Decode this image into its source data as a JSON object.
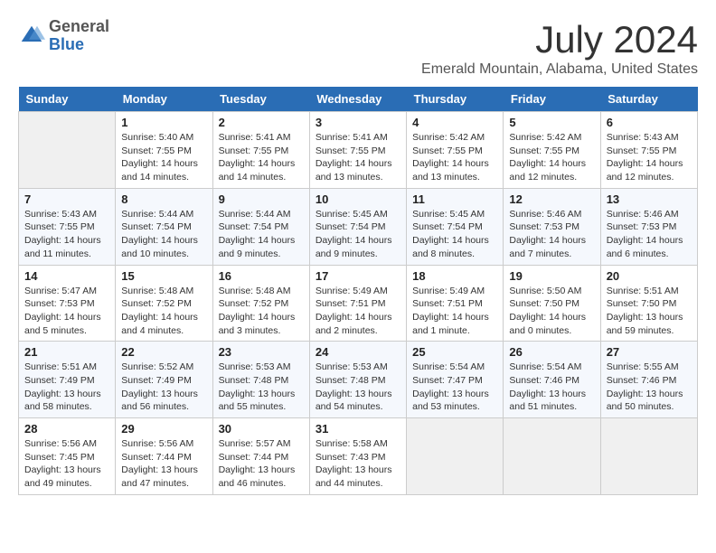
{
  "header": {
    "logo_general": "General",
    "logo_blue": "Blue",
    "month": "July 2024",
    "location": "Emerald Mountain, Alabama, United States"
  },
  "weekdays": [
    "Sunday",
    "Monday",
    "Tuesday",
    "Wednesday",
    "Thursday",
    "Friday",
    "Saturday"
  ],
  "weeks": [
    [
      {
        "day": "",
        "sunrise": "",
        "sunset": "",
        "daylight": "",
        "empty": true
      },
      {
        "day": "1",
        "sunrise": "Sunrise: 5:40 AM",
        "sunset": "Sunset: 7:55 PM",
        "daylight": "Daylight: 14 hours and 14 minutes."
      },
      {
        "day": "2",
        "sunrise": "Sunrise: 5:41 AM",
        "sunset": "Sunset: 7:55 PM",
        "daylight": "Daylight: 14 hours and 14 minutes."
      },
      {
        "day": "3",
        "sunrise": "Sunrise: 5:41 AM",
        "sunset": "Sunset: 7:55 PM",
        "daylight": "Daylight: 14 hours and 13 minutes."
      },
      {
        "day": "4",
        "sunrise": "Sunrise: 5:42 AM",
        "sunset": "Sunset: 7:55 PM",
        "daylight": "Daylight: 14 hours and 13 minutes."
      },
      {
        "day": "5",
        "sunrise": "Sunrise: 5:42 AM",
        "sunset": "Sunset: 7:55 PM",
        "daylight": "Daylight: 14 hours and 12 minutes."
      },
      {
        "day": "6",
        "sunrise": "Sunrise: 5:43 AM",
        "sunset": "Sunset: 7:55 PM",
        "daylight": "Daylight: 14 hours and 12 minutes."
      }
    ],
    [
      {
        "day": "7",
        "sunrise": "Sunrise: 5:43 AM",
        "sunset": "Sunset: 7:55 PM",
        "daylight": "Daylight: 14 hours and 11 minutes."
      },
      {
        "day": "8",
        "sunrise": "Sunrise: 5:44 AM",
        "sunset": "Sunset: 7:54 PM",
        "daylight": "Daylight: 14 hours and 10 minutes."
      },
      {
        "day": "9",
        "sunrise": "Sunrise: 5:44 AM",
        "sunset": "Sunset: 7:54 PM",
        "daylight": "Daylight: 14 hours and 9 minutes."
      },
      {
        "day": "10",
        "sunrise": "Sunrise: 5:45 AM",
        "sunset": "Sunset: 7:54 PM",
        "daylight": "Daylight: 14 hours and 9 minutes."
      },
      {
        "day": "11",
        "sunrise": "Sunrise: 5:45 AM",
        "sunset": "Sunset: 7:54 PM",
        "daylight": "Daylight: 14 hours and 8 minutes."
      },
      {
        "day": "12",
        "sunrise": "Sunrise: 5:46 AM",
        "sunset": "Sunset: 7:53 PM",
        "daylight": "Daylight: 14 hours and 7 minutes."
      },
      {
        "day": "13",
        "sunrise": "Sunrise: 5:46 AM",
        "sunset": "Sunset: 7:53 PM",
        "daylight": "Daylight: 14 hours and 6 minutes."
      }
    ],
    [
      {
        "day": "14",
        "sunrise": "Sunrise: 5:47 AM",
        "sunset": "Sunset: 7:53 PM",
        "daylight": "Daylight: 14 hours and 5 minutes."
      },
      {
        "day": "15",
        "sunrise": "Sunrise: 5:48 AM",
        "sunset": "Sunset: 7:52 PM",
        "daylight": "Daylight: 14 hours and 4 minutes."
      },
      {
        "day": "16",
        "sunrise": "Sunrise: 5:48 AM",
        "sunset": "Sunset: 7:52 PM",
        "daylight": "Daylight: 14 hours and 3 minutes."
      },
      {
        "day": "17",
        "sunrise": "Sunrise: 5:49 AM",
        "sunset": "Sunset: 7:51 PM",
        "daylight": "Daylight: 14 hours and 2 minutes."
      },
      {
        "day": "18",
        "sunrise": "Sunrise: 5:49 AM",
        "sunset": "Sunset: 7:51 PM",
        "daylight": "Daylight: 14 hours and 1 minute."
      },
      {
        "day": "19",
        "sunrise": "Sunrise: 5:50 AM",
        "sunset": "Sunset: 7:50 PM",
        "daylight": "Daylight: 14 hours and 0 minutes."
      },
      {
        "day": "20",
        "sunrise": "Sunrise: 5:51 AM",
        "sunset": "Sunset: 7:50 PM",
        "daylight": "Daylight: 13 hours and 59 minutes."
      }
    ],
    [
      {
        "day": "21",
        "sunrise": "Sunrise: 5:51 AM",
        "sunset": "Sunset: 7:49 PM",
        "daylight": "Daylight: 13 hours and 58 minutes."
      },
      {
        "day": "22",
        "sunrise": "Sunrise: 5:52 AM",
        "sunset": "Sunset: 7:49 PM",
        "daylight": "Daylight: 13 hours and 56 minutes."
      },
      {
        "day": "23",
        "sunrise": "Sunrise: 5:53 AM",
        "sunset": "Sunset: 7:48 PM",
        "daylight": "Daylight: 13 hours and 55 minutes."
      },
      {
        "day": "24",
        "sunrise": "Sunrise: 5:53 AM",
        "sunset": "Sunset: 7:48 PM",
        "daylight": "Daylight: 13 hours and 54 minutes."
      },
      {
        "day": "25",
        "sunrise": "Sunrise: 5:54 AM",
        "sunset": "Sunset: 7:47 PM",
        "daylight": "Daylight: 13 hours and 53 minutes."
      },
      {
        "day": "26",
        "sunrise": "Sunrise: 5:54 AM",
        "sunset": "Sunset: 7:46 PM",
        "daylight": "Daylight: 13 hours and 51 minutes."
      },
      {
        "day": "27",
        "sunrise": "Sunrise: 5:55 AM",
        "sunset": "Sunset: 7:46 PM",
        "daylight": "Daylight: 13 hours and 50 minutes."
      }
    ],
    [
      {
        "day": "28",
        "sunrise": "Sunrise: 5:56 AM",
        "sunset": "Sunset: 7:45 PM",
        "daylight": "Daylight: 13 hours and 49 minutes."
      },
      {
        "day": "29",
        "sunrise": "Sunrise: 5:56 AM",
        "sunset": "Sunset: 7:44 PM",
        "daylight": "Daylight: 13 hours and 47 minutes."
      },
      {
        "day": "30",
        "sunrise": "Sunrise: 5:57 AM",
        "sunset": "Sunset: 7:44 PM",
        "daylight": "Daylight: 13 hours and 46 minutes."
      },
      {
        "day": "31",
        "sunrise": "Sunrise: 5:58 AM",
        "sunset": "Sunset: 7:43 PM",
        "daylight": "Daylight: 13 hours and 44 minutes."
      },
      {
        "day": "",
        "sunrise": "",
        "sunset": "",
        "daylight": "",
        "empty": true
      },
      {
        "day": "",
        "sunrise": "",
        "sunset": "",
        "daylight": "",
        "empty": true
      },
      {
        "day": "",
        "sunrise": "",
        "sunset": "",
        "daylight": "",
        "empty": true
      }
    ]
  ]
}
